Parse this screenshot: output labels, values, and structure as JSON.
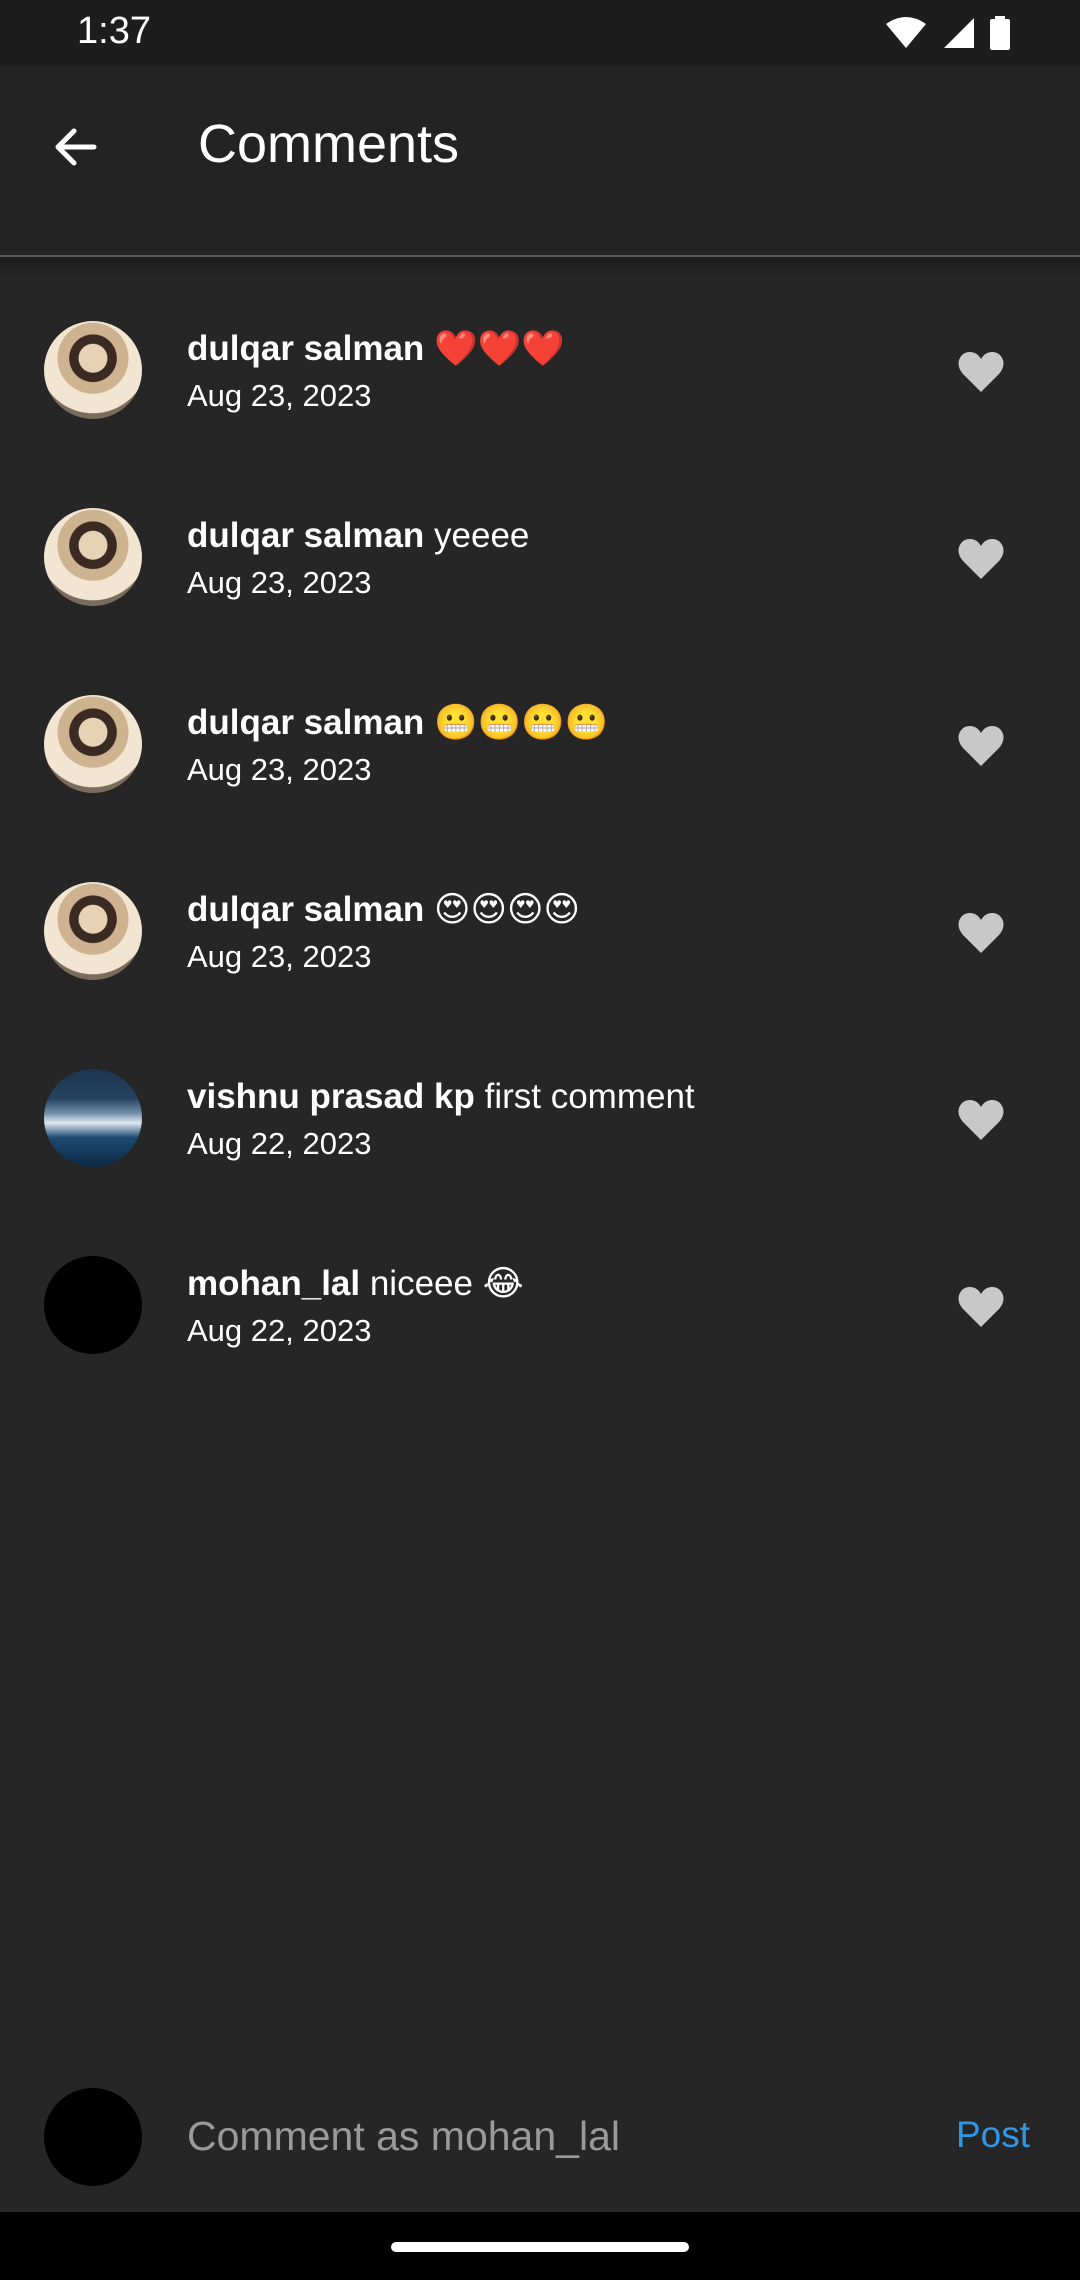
{
  "status_bar": {
    "time": "1:37",
    "icons": [
      "wifi-icon",
      "cellular-signal-icon",
      "battery-icon"
    ]
  },
  "app_bar": {
    "title": "Comments",
    "back_icon": "arrow-back-icon"
  },
  "comments": [
    {
      "username": "dulqar salman",
      "text": "❤️❤️❤️",
      "date": "Aug 23, 2023",
      "avatar": "person-photo"
    },
    {
      "username": "dulqar salman",
      "text": "yeeee",
      "date": "Aug 23, 2023",
      "avatar": "person-photo"
    },
    {
      "username": "dulqar salman",
      "text": "😬😬😬😬",
      "date": "Aug 23, 2023",
      "avatar": "person-photo"
    },
    {
      "username": "dulqar salman",
      "text": "😍😍😍😍",
      "date": "Aug 23, 2023",
      "avatar": "person-photo"
    },
    {
      "username": "vishnu prasad kp",
      "text": "first comment",
      "date": "Aug 22, 2023",
      "avatar": "landscape-photo"
    },
    {
      "username": "mohan_lal",
      "text": "niceee 😂",
      "date": "Aug 22, 2023",
      "avatar": "blank"
    }
  ],
  "composer": {
    "placeholder": "Comment as mohan_lal",
    "value": "",
    "post_label": "Post"
  },
  "colors": {
    "background": "#262626",
    "app_bar": "#232323",
    "accent": "#2f97e8",
    "like_icon": "#c8c8c8"
  }
}
